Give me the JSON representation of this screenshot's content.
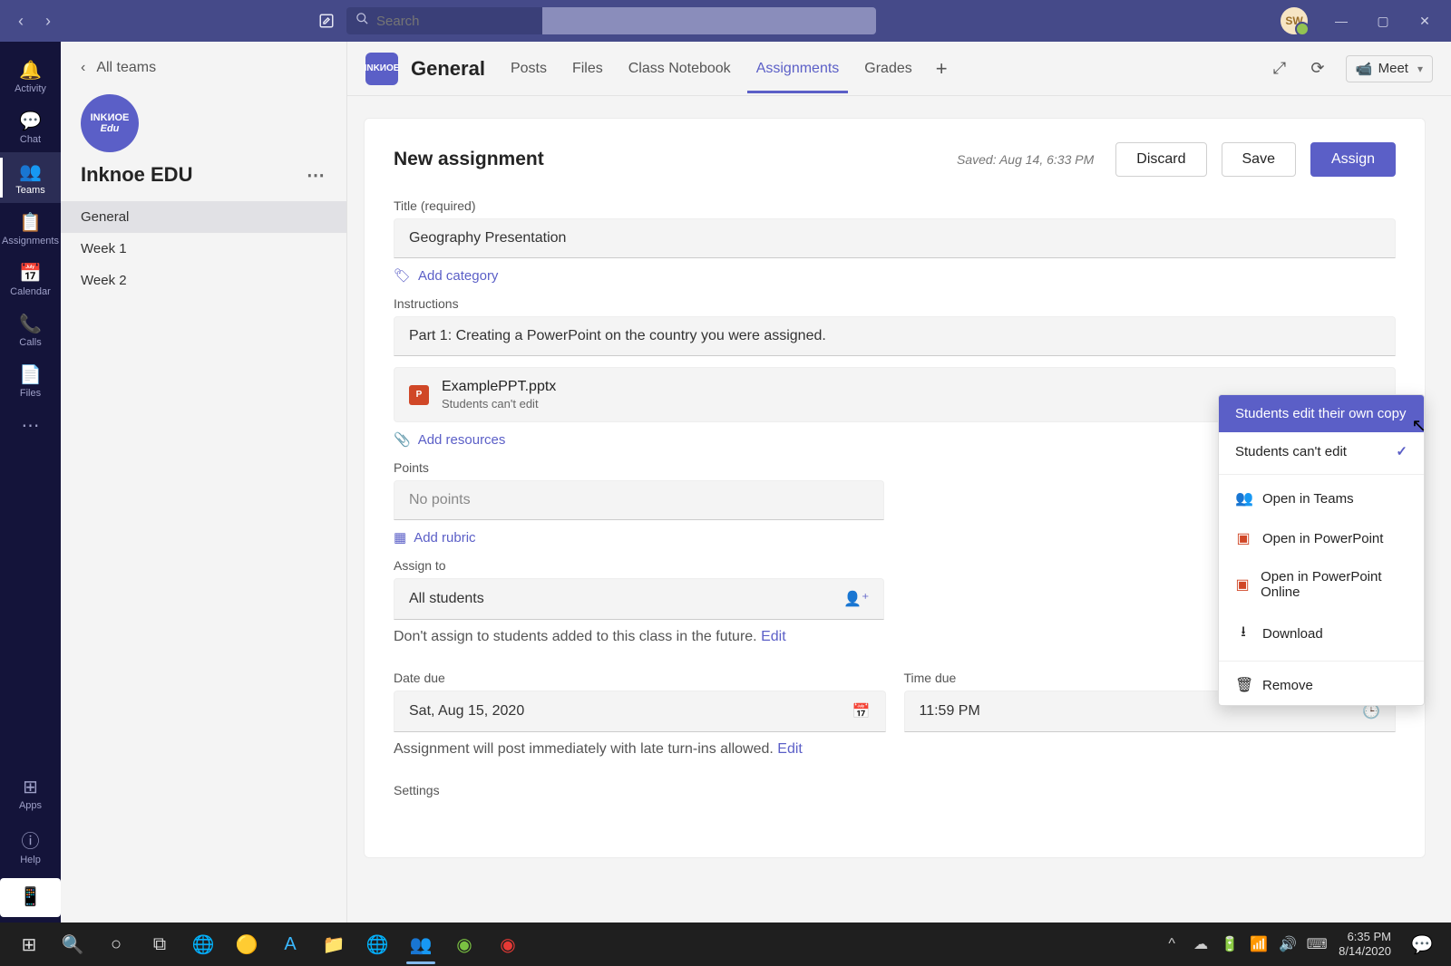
{
  "titlebar": {
    "search_placeholder": "Search",
    "user_initials": "SW"
  },
  "rail": {
    "items": [
      {
        "label": "Activity",
        "icon": "🔔"
      },
      {
        "label": "Chat",
        "icon": "💬"
      },
      {
        "label": "Teams",
        "icon": "👥"
      },
      {
        "label": "Assignments",
        "icon": "📋"
      },
      {
        "label": "Calendar",
        "icon": "📅"
      },
      {
        "label": "Calls",
        "icon": "📞"
      },
      {
        "label": "Files",
        "icon": "📄"
      }
    ],
    "more_icon": "⋯",
    "apps_label": "Apps",
    "help_label": "Help"
  },
  "teamside": {
    "back_label": "All teams",
    "logo_line1": "INKИOE",
    "logo_line2": "Edu",
    "team_name": "Inknoe EDU",
    "channels": [
      {
        "label": "General"
      },
      {
        "label": "Week 1"
      },
      {
        "label": "Week 2"
      }
    ]
  },
  "chanbar": {
    "chip_text": "INKИOE",
    "channel_name": "General",
    "tabs": [
      {
        "label": "Posts"
      },
      {
        "label": "Files"
      },
      {
        "label": "Class Notebook"
      },
      {
        "label": "Assignments"
      },
      {
        "label": "Grades"
      }
    ],
    "meet_label": "Meet"
  },
  "assignment": {
    "page_title": "New assignment",
    "saved_text": "Saved: Aug 14, 6:33 PM",
    "discard_btn": "Discard",
    "save_btn": "Save",
    "assign_btn": "Assign",
    "title_label": "Title (required)",
    "title_value": "Geography Presentation",
    "add_category": "Add category",
    "instructions_label": "Instructions",
    "instructions_value": "Part 1: Creating a PowerPoint on the country you were assigned.",
    "attachment": {
      "filename": "ExamplePPT.pptx",
      "subtext": "Students can't edit"
    },
    "add_resources": "Add resources",
    "points_label": "Points",
    "points_value": "No points",
    "add_rubric": "Add rubric",
    "assign_to_label": "Assign to",
    "assign_to_value": "All students",
    "assign_future_text": "Don't assign to students added to this class in the future. ",
    "edit_link": "Edit",
    "date_due_label": "Date due",
    "date_due_value": "Sat, Aug 15, 2020",
    "time_due_label": "Time due",
    "time_due_value": "11:59 PM",
    "post_text": "Assignment will post immediately with late turn-ins allowed. ",
    "settings_label": "Settings"
  },
  "context_menu": {
    "opt_edit_copy": "Students edit their own copy",
    "opt_cant_edit": "Students can't edit",
    "open_teams": "Open in Teams",
    "open_ppt": "Open in PowerPoint",
    "open_ppt_online": "Open in PowerPoint Online",
    "download": "Download",
    "remove": "Remove"
  },
  "taskbar": {
    "time": "6:35 PM",
    "date": "8/14/2020"
  }
}
